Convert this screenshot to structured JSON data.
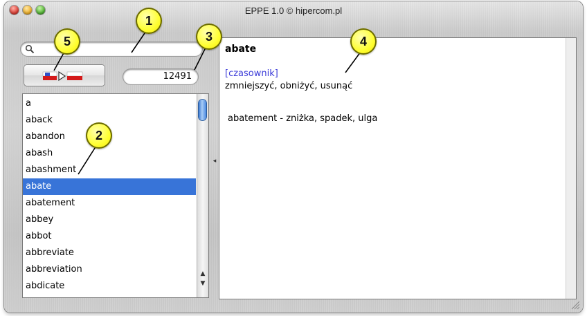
{
  "window": {
    "title": "EPPE 1.0 © hipercom.pl"
  },
  "search": {
    "value": "",
    "placeholder": ""
  },
  "word_count": "12491",
  "word_list": {
    "items": [
      "a",
      "aback",
      "abandon",
      "abash",
      "abashment",
      "abate",
      "abatement",
      "abbey",
      "abbot",
      "abbreviate",
      "abbreviation",
      "abdicate"
    ],
    "selected": "abate"
  },
  "definition": {
    "headword": "abate",
    "part_of_speech": "[czasownik]",
    "meaning": "zmniejszyć, obniżyć, usunąć",
    "derived": "abatement - zniżka, spadek, ulga"
  },
  "callouts": [
    "1",
    "2",
    "3",
    "4",
    "5"
  ],
  "colors": {
    "selection": "#3874d8",
    "part_of_speech": "#3b3bd8",
    "callout": "#ffff33"
  },
  "icons": {
    "search": "magnifier-icon",
    "speak": "speak-pl-flag-icon"
  }
}
